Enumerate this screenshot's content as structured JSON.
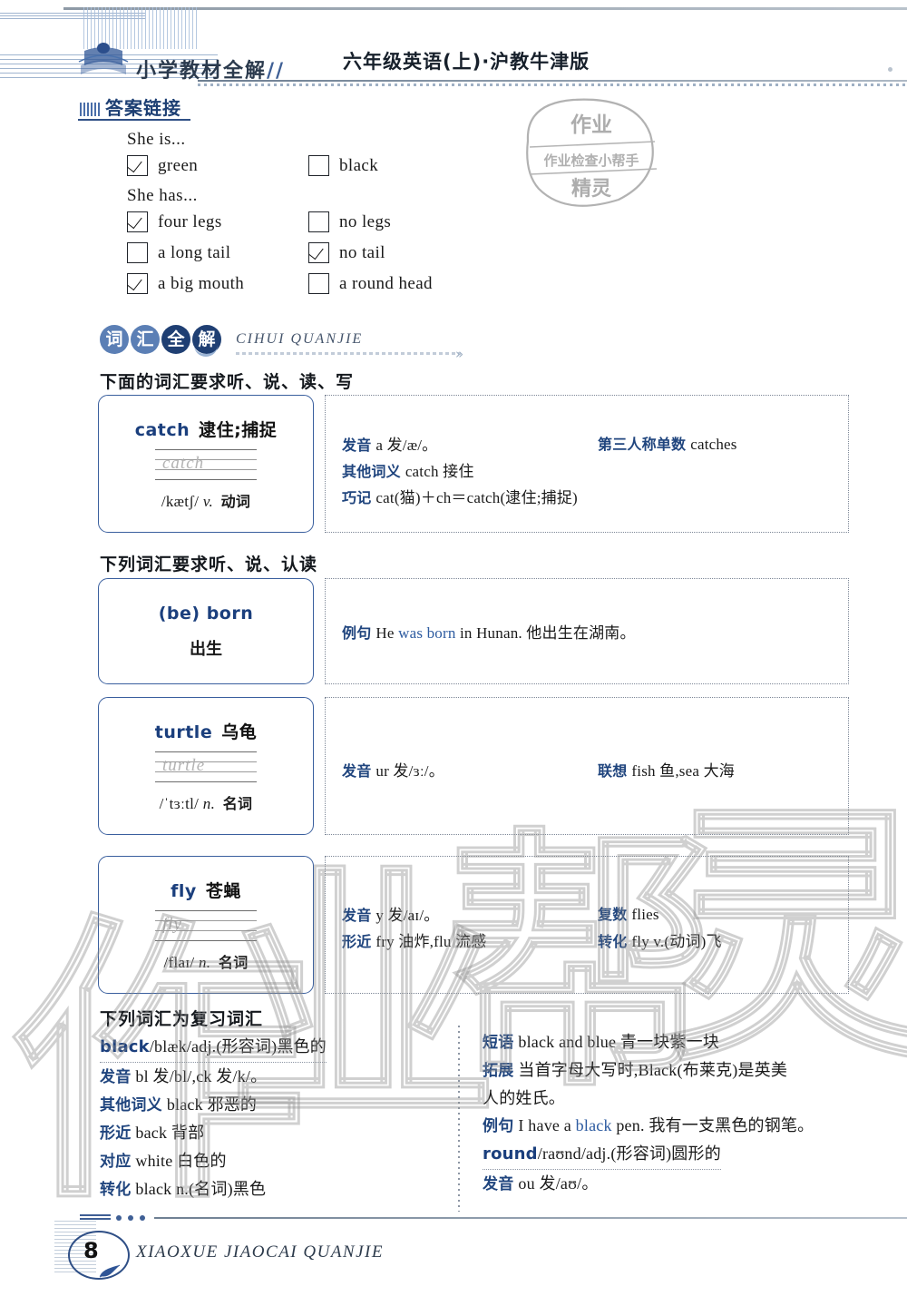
{
  "header": {
    "brand": "小学教材全解",
    "brand_chars": [
      "小",
      "学",
      "教",
      "材",
      "全",
      "解"
    ],
    "title": "六年级英语(上)·沪教牛津版",
    "logo_icon": "open-book-icon"
  },
  "stamp": {
    "top": "作业",
    "middle": "作业检查小帮手",
    "bottom": "精灵"
  },
  "watermark": {
    "chars": [
      "作",
      "业",
      "帮",
      "灵"
    ]
  },
  "answer_section": {
    "heading": "答案链接",
    "prompt1": "She is...",
    "prompt2": "She has...",
    "rows": [
      [
        {
          "label": "green",
          "checked": true
        },
        {
          "label": "black",
          "checked": false
        }
      ],
      [
        {
          "label": "four legs",
          "checked": true
        },
        {
          "label": "no legs",
          "checked": false
        }
      ],
      [
        {
          "label": "a long tail",
          "checked": false
        },
        {
          "label": "no tail",
          "checked": true
        }
      ],
      [
        {
          "label": "a big mouth",
          "checked": true
        },
        {
          "label": "a round head",
          "checked": false
        }
      ]
    ]
  },
  "vocab_section": {
    "banner_chars": [
      "词",
      "汇",
      "全",
      "解"
    ],
    "banner_pinyin": "CIHUI QUANJIE",
    "instr1": "下面的词汇要求听、说、读、写",
    "instr2": "下列词汇要求听、说、认读",
    "instr3": "下列词汇为复习词汇"
  },
  "words": {
    "catch": {
      "word": "catch",
      "meaning": "逮住;捕捉",
      "practice": "catch",
      "phonetic": "/kætʃ/",
      "pos": "v.",
      "pos_cn": "动词",
      "notes": {
        "n1_key": "发音",
        "n1_text": "a 发/æ/。",
        "n2_key": "第三人称单数",
        "n2_text": "catches",
        "n3_key": "其他词义",
        "n3_text": "catch 接住",
        "n4_key": "巧记",
        "n4_text": "cat(猫)＋ch＝catch(逮住;捕捉)"
      }
    },
    "born": {
      "word": "(be) born",
      "meaning": "出生",
      "notes": {
        "n1_key": "例句",
        "n1_pre": "He ",
        "n1_hl": "was born",
        "n1_post": " in Hunan. 他出生在湖南。"
      }
    },
    "turtle": {
      "word": "turtle",
      "meaning": "乌龟",
      "practice": "turtle",
      "phonetic": "/ˈtɜːtl/",
      "pos": "n.",
      "pos_cn": "名词",
      "notes": {
        "n1_key": "发音",
        "n1_text": "ur 发/ɜː/。",
        "n2_key": "联想",
        "n2_text": "fish 鱼,sea 大海"
      }
    },
    "fly": {
      "word": "fly",
      "meaning": "苍蝇",
      "practice": "fly",
      "phonetic": "/flaɪ/",
      "pos": "n.",
      "pos_cn": "名词",
      "notes": {
        "n1_key": "发音",
        "n1_text": "y 发/aɪ/。",
        "n2_key": "复数",
        "n2_text": "flies",
        "n3_key": "形近",
        "n3_text": "fry 油炸,flu 流感",
        "n4_key": "转化",
        "n4_text": "fly v.(动词)飞"
      }
    }
  },
  "review": {
    "left": {
      "entry_word": "black",
      "entry_rest": "/blæk/adj.(形容词)黑色的",
      "lines": [
        {
          "key": "发音",
          "text": "bl 发/bl/,ck 发/k/。"
        },
        {
          "key": "其他词义",
          "text": "black 邪恶的"
        },
        {
          "key": "形近",
          "text": "back 背部"
        },
        {
          "key": "对应",
          "text": "white 白色的"
        },
        {
          "key": "转化",
          "text": "black n.(名词)黑色"
        }
      ]
    },
    "right": {
      "lines": [
        {
          "key": "短语",
          "text": "black and blue 青一块紫一块"
        },
        {
          "key": "拓展",
          "text": "当首字母大写时,Black(布莱克)是英美"
        },
        {
          "key": "",
          "text": "人的姓氏。"
        },
        {
          "key": "例句",
          "pre": "I have a ",
          "hl": "black",
          "post": " pen. 我有一支黑色的钢笔。"
        }
      ],
      "entry_word": "round",
      "entry_rest": "/raʊnd/adj.(形容词)圆形的",
      "after": [
        {
          "key": "发音",
          "text": "ou 发/aʊ/。"
        }
      ]
    }
  },
  "footer": {
    "page_number": "8",
    "text": "XIAOXUE JIAOCAI QUANJIE",
    "leaf_icon": "leaf-icon"
  }
}
